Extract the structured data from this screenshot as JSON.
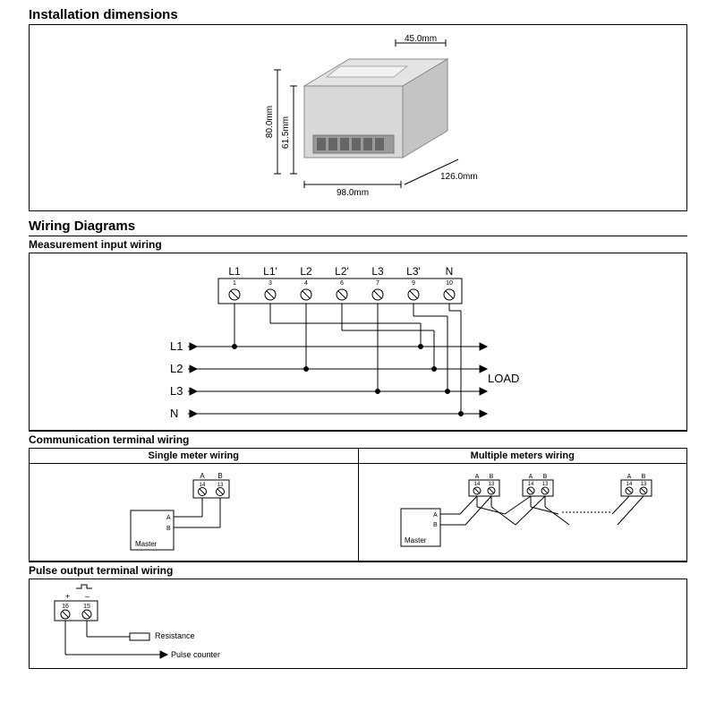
{
  "install": {
    "title": "Installation dimensions",
    "dims": {
      "top": "45.0mm",
      "left_outer": "80.0mm",
      "left_inner": "61.5mm",
      "bottom_left": "98.0mm",
      "bottom_right": "126.0mm"
    }
  },
  "wiring": {
    "title": "Wiring Diagrams",
    "measurement": {
      "title": "Measurement input wiring",
      "terminals_top": [
        "L1",
        "L1'",
        "L2",
        "L2'",
        "L3",
        "L3'",
        "N"
      ],
      "terminals_num": [
        "1",
        "3",
        "4",
        "6",
        "7",
        "9",
        "10"
      ],
      "lines": [
        "L1",
        "L2",
        "L3",
        "N"
      ],
      "load": "LOAD"
    },
    "comm": {
      "title": "Communication terminal wiring",
      "single": "Single meter wiring",
      "multiple": "Multiple meters wiring",
      "labels": {
        "a": "A",
        "b": "B",
        "t14": "14",
        "t13": "13",
        "master": "Master"
      }
    },
    "pulse": {
      "title": "Pulse output terminal wiring",
      "t16": "16",
      "t15": "15",
      "plus": "+",
      "minus": "–",
      "res": "Resistance",
      "counter": "Pulse counter"
    }
  }
}
